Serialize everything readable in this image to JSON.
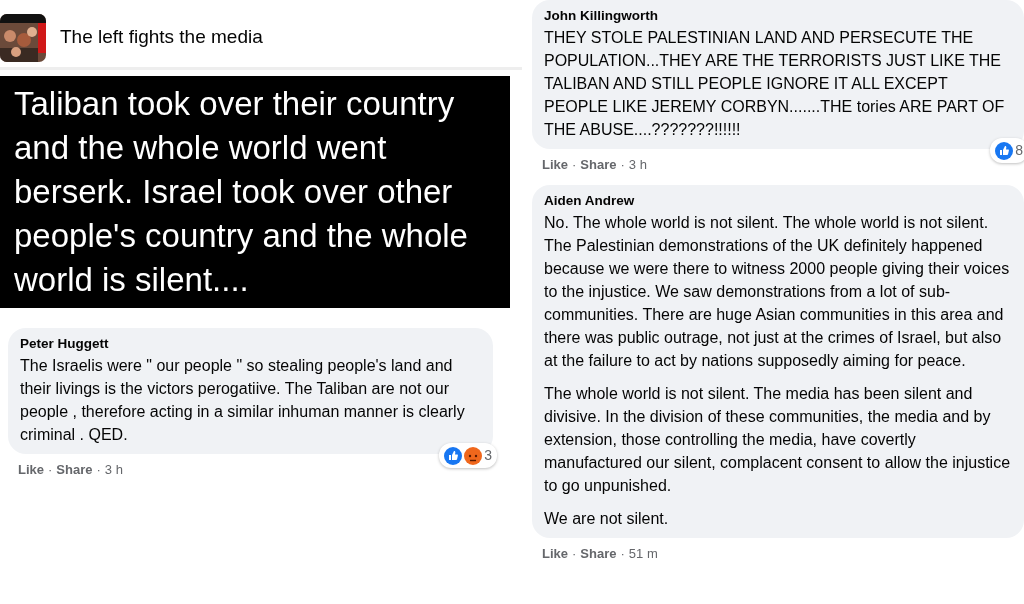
{
  "left": {
    "group_name": "The left fights the media",
    "meme_text": "Taliban took over their country and the whole world went berserk. Israel took over other people's country and the whole world is silent....",
    "comments": [
      {
        "author": "Peter Huggett",
        "paragraphs": [
          "The Israelis were \" our people \" so stealing people's land and their livings is the victors perogatiive. The Taliban are not our people , therefore acting in a similar inhuman manner is clearly criminal . QED."
        ],
        "reactions": [
          {
            "kind": "like"
          },
          {
            "kind": "angry"
          }
        ],
        "reaction_count": "3",
        "actions": [
          "Like",
          "·",
          "Share",
          "·"
        ],
        "time": "3 h"
      }
    ]
  },
  "right": {
    "comments": [
      {
        "author": "John Killingworth",
        "paragraphs": [
          "THEY STOLE PALESTINIAN LAND AND PERSECUTE THE POPULATION...THEY ARE THE TERRORISTS JUST LIKE THE TALIBAN AND STILL PEOPLE IGNORE IT ALL EXCEPT PEOPLE LIKE JEREMY CORBYN.......THE tories ARE PART OF THE ABUSE....???????!!!!!!"
        ],
        "reactions": [
          {
            "kind": "like"
          }
        ],
        "reaction_count": "8",
        "actions": [
          "Like",
          "·",
          "Share",
          "·"
        ],
        "time": "3 h"
      },
      {
        "author": "Aiden Andrew",
        "paragraphs": [
          "No. The whole world is not silent. The whole world is not silent. The Palestinian demonstrations of the UK definitely happened because we were there to witness 2000 people giving their voices to the injustice. We saw demonstrations from a lot of sub-communities. There are huge Asian communities in this area and there was public outrage, not just at the crimes of Israel, but also at the failure to act by nations supposedly aiming for peace.",
          "The whole world is not silent. The media has been silent and divisive. In the division of these communities, the media and by extension, those controlling the media, have covertly manufactured our silent, complacent consent to allow the injustice to go unpunished.",
          "We are not silent."
        ],
        "actions": [
          "Like",
          "·",
          "Share",
          "·"
        ],
        "time": "51 m"
      }
    ]
  }
}
